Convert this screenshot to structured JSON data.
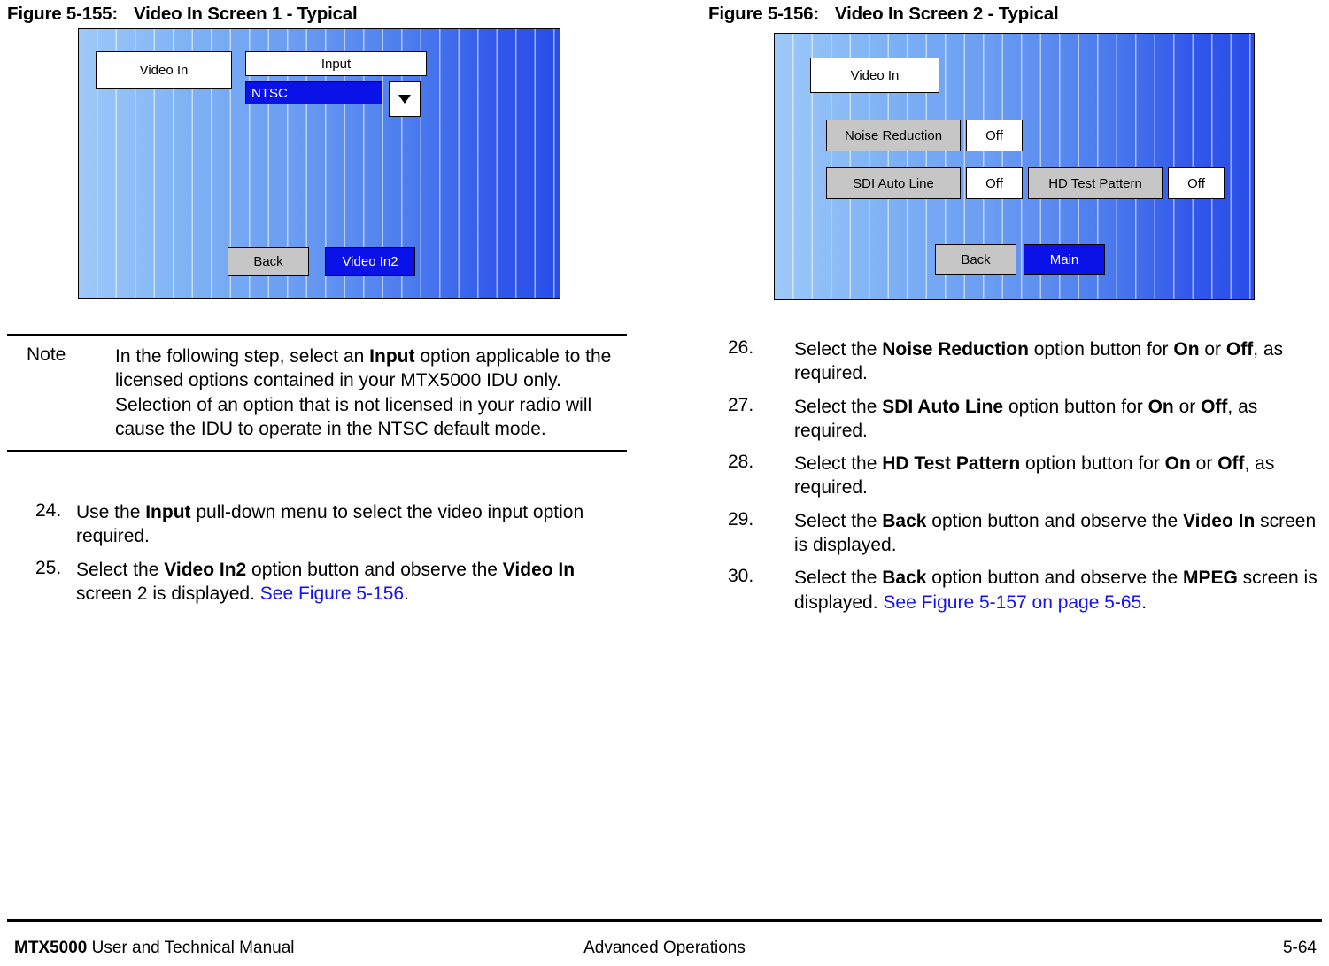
{
  "figures": [
    {
      "title_num": "Figure 5-155:",
      "title_text": "Video In Screen 1 - Typical",
      "screen_label": "Video In",
      "input_header": "Input",
      "input_value": "NTSC",
      "dropdown_icon": "chevron-down-icon",
      "back_label": "Back",
      "next_label": "Video In2"
    },
    {
      "title_num": "Figure 5-156:",
      "title_text": "Video In Screen 2 - Typical",
      "screen_label": "Video In",
      "options": [
        {
          "label": "Noise Reduction",
          "value": "Off"
        },
        {
          "label": "SDI Auto Line",
          "value": "Off"
        },
        {
          "label": "HD Test Pattern",
          "value": "Off"
        }
      ],
      "back_label": "Back",
      "main_label": "Main"
    }
  ],
  "note": {
    "label": "Note",
    "line1_a": "In the following step, select an ",
    "line1_b": "Input",
    "line1_c": " option applicable to the licensed options contained in your MTX5000 IDU only.  Selection of an option that is not licensed in your radio will cause the IDU to operate in the NTSC default mode."
  },
  "steps_left": [
    {
      "num": "24.",
      "a": "Use the ",
      "b1": "Input",
      "c": " pull-down menu to select the video input option required.",
      "b2": "",
      "d": "",
      "link": ""
    },
    {
      "num": "25.",
      "a": "Select the ",
      "b1": "Video In2",
      "c": " option button and observe the ",
      "b2": "Video In",
      "d": " screen 2 is displayed.  ",
      "link": "See Figure 5-156",
      "tail": "."
    }
  ],
  "steps_right": [
    {
      "num": "26.",
      "a": "Select the ",
      "b1": "Noise Reduction",
      "c": " option button for ",
      "b2": "On",
      "d": " or ",
      "b3": "Off",
      "e": ", as required.",
      "link": "",
      "tail": ""
    },
    {
      "num": "27.",
      "a": "Select the ",
      "b1": "SDI Auto Line",
      "c": " option button for ",
      "b2": "On",
      "d": " or ",
      "b3": "Off",
      "e": ", as required.",
      "link": "",
      "tail": ""
    },
    {
      "num": "28.",
      "a": "Select the ",
      "b1": "HD Test Pattern",
      "c": " option button for ",
      "b2": "On",
      "d": " or ",
      "b3": "Off",
      "e": ", as required.",
      "link": "",
      "tail": ""
    },
    {
      "num": "29.",
      "a": "Select the ",
      "b1": "Back",
      "c": " option button and observe the ",
      "b2": "Video In",
      "d": " screen is displayed.",
      "b3": "",
      "e": "",
      "link": "",
      "tail": ""
    },
    {
      "num": "30.",
      "a": "Select the ",
      "b1": "Back",
      "c": " option button and observe the ",
      "b2": "MPEG",
      "d": " screen is displayed.  ",
      "b3": "",
      "e": "",
      "link": "See Figure 5-157 on page 5-65",
      "tail": "."
    }
  ],
  "footer": {
    "left_bold": "MTX5000",
    "left_rest": " User and Technical Manual",
    "center": "Advanced Operations",
    "right": "5-64"
  },
  "colors": {
    "link": "#1612F0",
    "screen_blue_light": "#9EC9F8",
    "screen_blue_dark": "#2A4FE9",
    "button_grey": "#C6C6C6",
    "button_blue": "#0A12E8"
  }
}
